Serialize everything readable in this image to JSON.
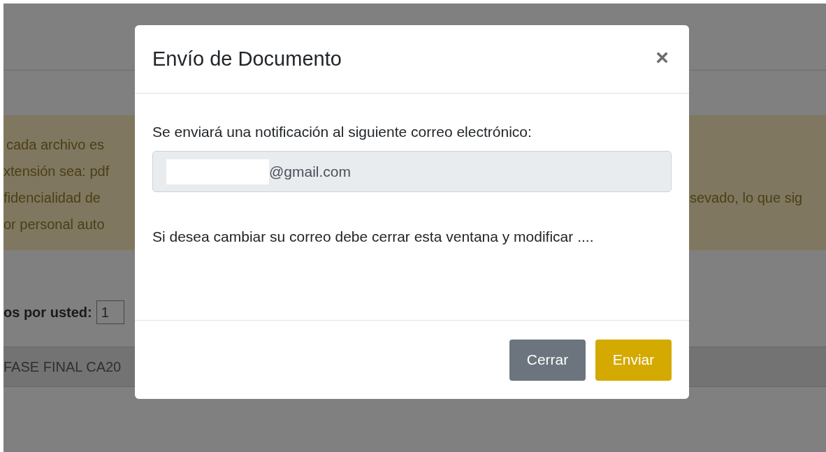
{
  "background_page": {
    "notice_lines_left": [
      "cada archivo es",
      "xtensión sea: pdf",
      "fidencialidad de",
      "or personal auto"
    ],
    "notice_line_right": "sevado, lo que sig",
    "count_label": "os por usted:",
    "count_input": {
      "value": "1"
    },
    "table_row": {
      "cell": "FASE FINAL CA20"
    }
  },
  "dialog": {
    "title": "Envío de Documento",
    "close": "×",
    "message": "Se enviará una notificación al siguiente correo electrónico:",
    "email_field": {
      "value": "@gmail.com",
      "redacted": true
    },
    "note": "Si desea cambiar su correo debe cerrar esta ventana y modificar ....",
    "buttons": [
      {
        "label": "Cerrar",
        "kind": "secondary"
      },
      {
        "label": "Enviar",
        "kind": "primary"
      }
    ]
  }
}
